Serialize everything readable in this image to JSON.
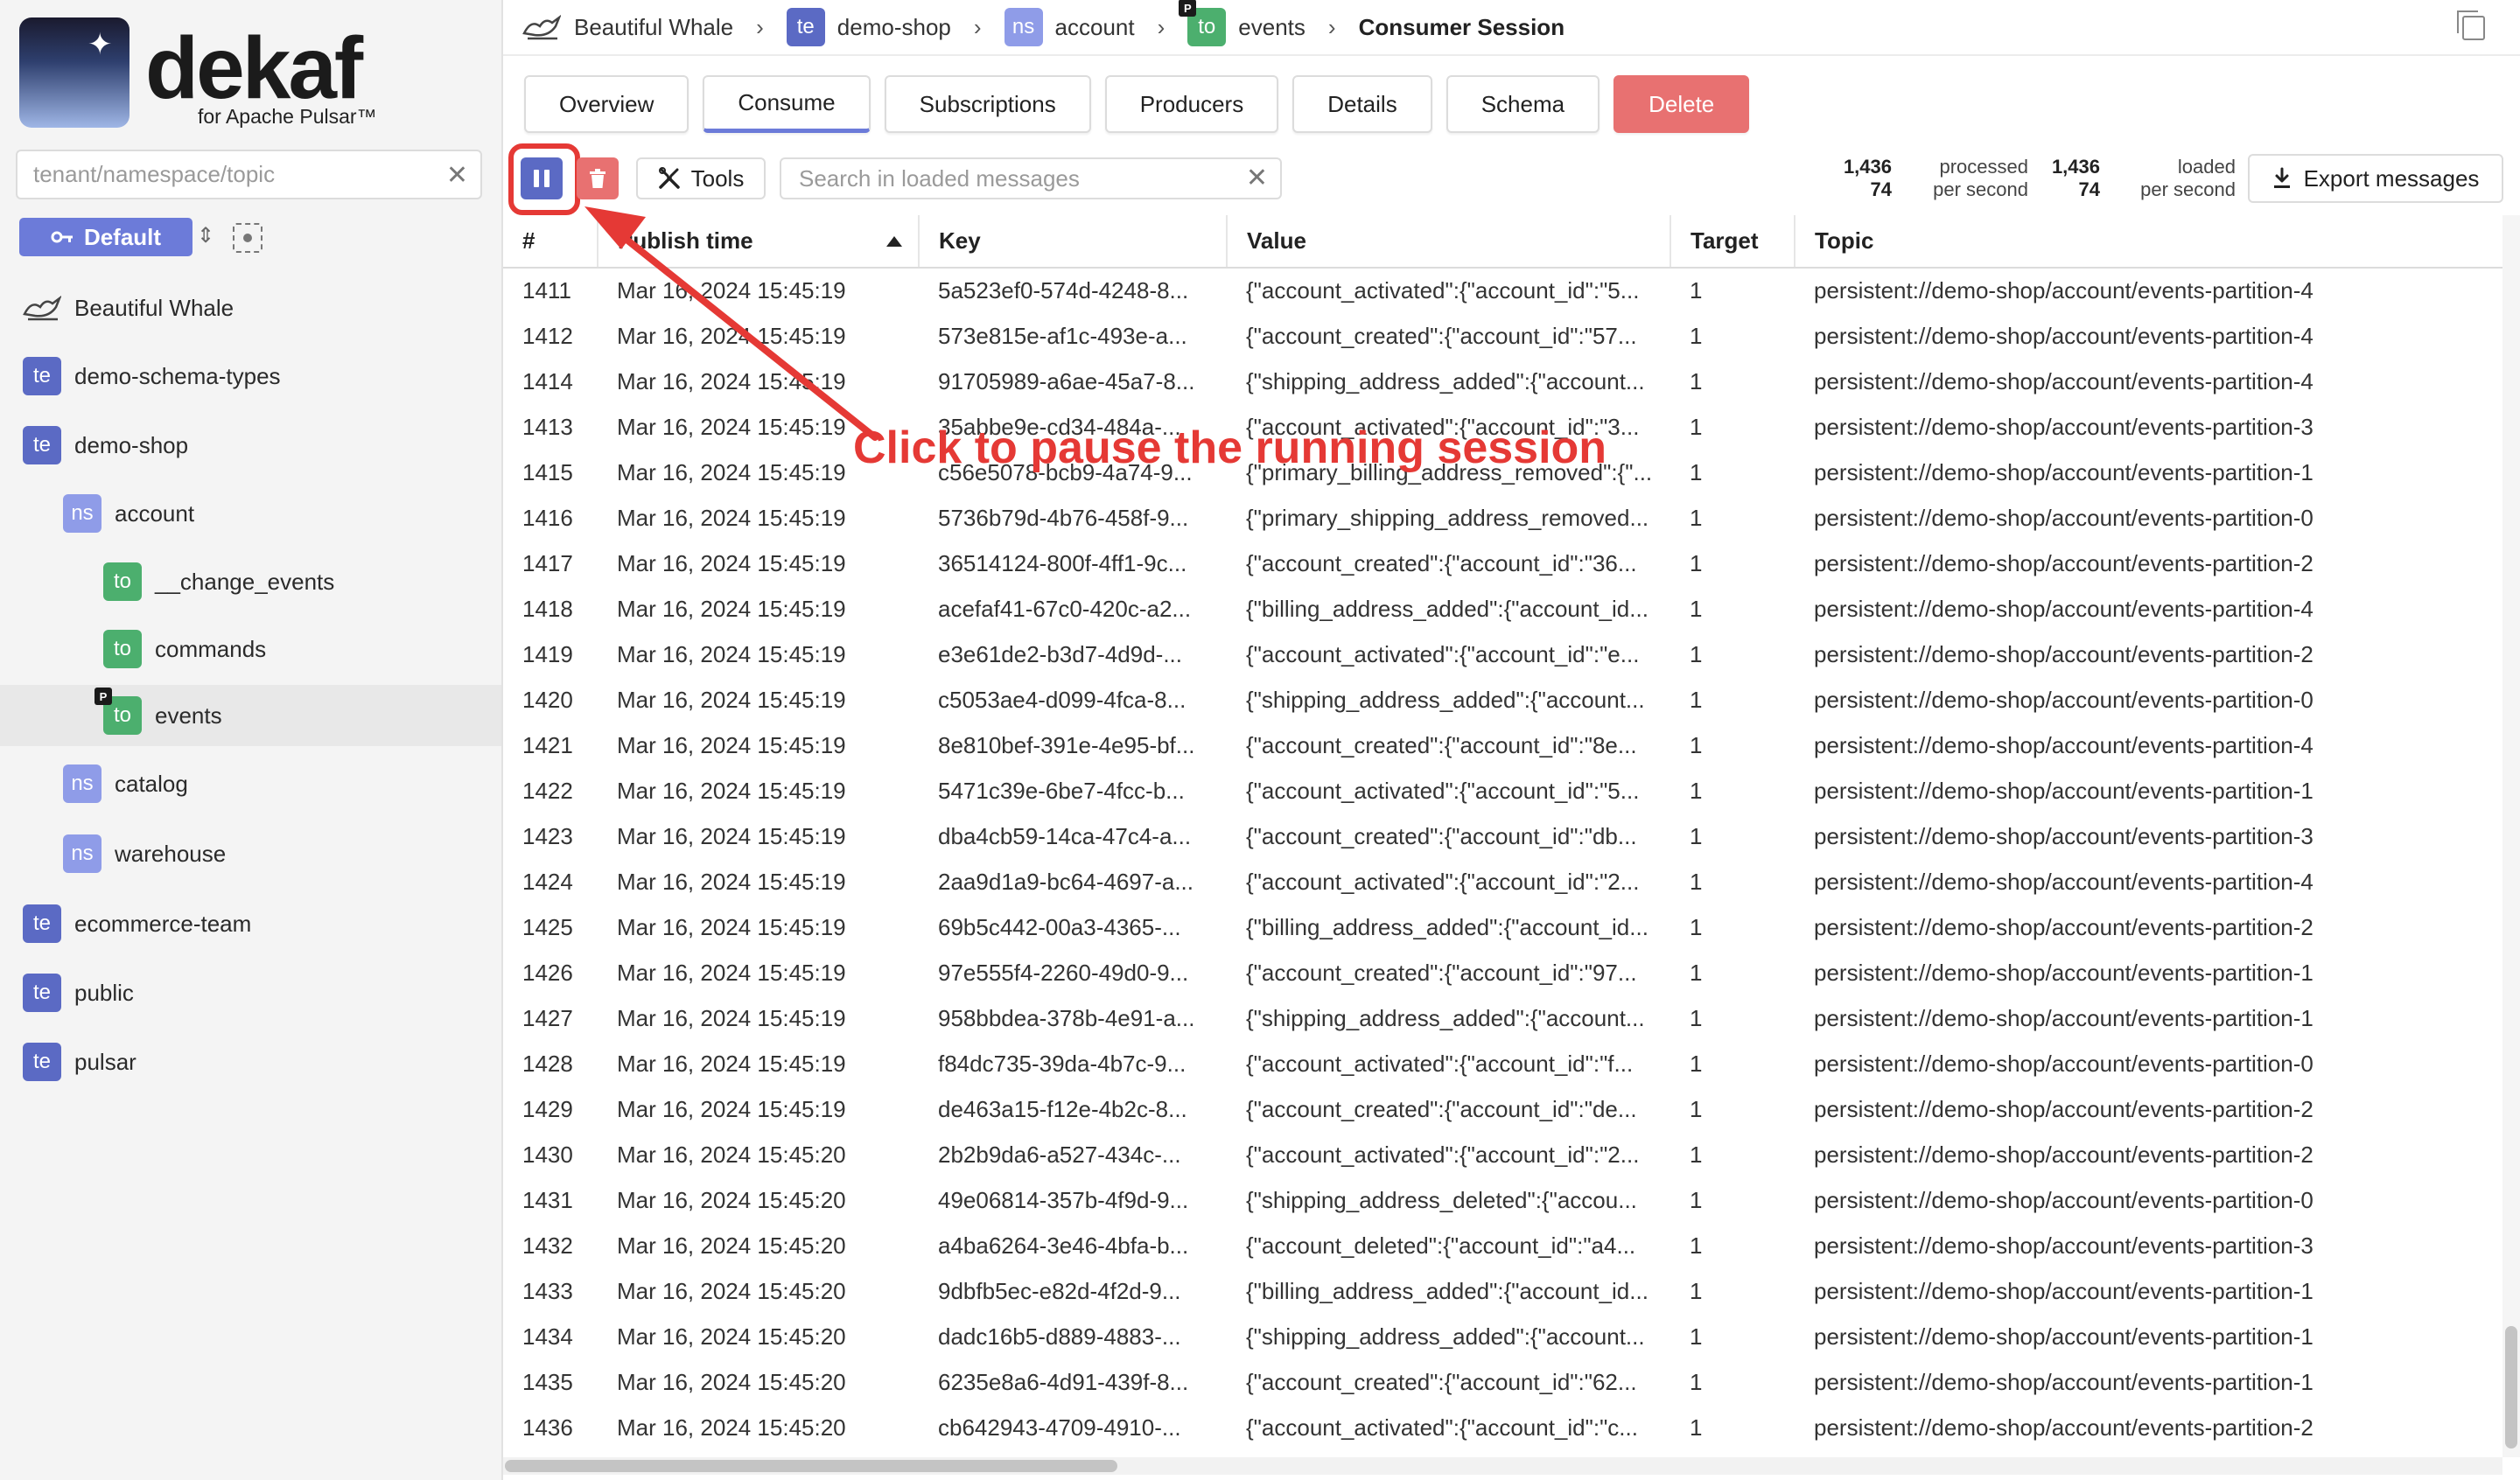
{
  "app": {
    "logo_text": "dekaf",
    "logo_sub": "for Apache Pulsar™"
  },
  "sidebar": {
    "filter_placeholder": "tenant/namespace/topic",
    "default_button": "Default",
    "items": [
      {
        "badge": "",
        "label": "Beautiful Whale"
      },
      {
        "badge": "te",
        "label": "demo-schema-types"
      },
      {
        "badge": "te",
        "label": "demo-shop"
      },
      {
        "badge": "ns",
        "label": "account"
      },
      {
        "badge": "to",
        "label": "__change_events"
      },
      {
        "badge": "to",
        "label": "commands"
      },
      {
        "badge": "to",
        "label": "events",
        "flag": "P"
      },
      {
        "badge": "ns",
        "label": "catalog"
      },
      {
        "badge": "ns",
        "label": "warehouse"
      },
      {
        "badge": "te",
        "label": "ecommerce-team"
      },
      {
        "badge": "te",
        "label": "public"
      },
      {
        "badge": "te",
        "label": "pulsar"
      }
    ]
  },
  "breadcrumb": {
    "cluster": "Beautiful Whale",
    "tenant_badge": "te",
    "tenant": "demo-shop",
    "namespace_badge": "ns",
    "namespace": "account",
    "topic_badge": "to",
    "topic_flag": "P",
    "topic": "events",
    "current": "Consumer Session"
  },
  "tabs": [
    {
      "label": "Overview"
    },
    {
      "label": "Consume"
    },
    {
      "label": "Subscriptions"
    },
    {
      "label": "Producers"
    },
    {
      "label": "Details"
    },
    {
      "label": "Schema"
    },
    {
      "label": "Delete"
    }
  ],
  "toolbar": {
    "tools_label": "Tools",
    "search_placeholder": "Search in loaded messages",
    "processed_total": "1,436",
    "processed_rate": "74",
    "processed_label_1": "processed",
    "processed_label_2": "per second",
    "loaded_total": "1,436",
    "loaded_rate": "74",
    "loaded_label_1": "loaded",
    "loaded_label_2": "per second",
    "export_label": "Export messages"
  },
  "table": {
    "columns": [
      "#",
      "Publish time",
      "Key",
      "Value",
      "Target",
      "Topic"
    ],
    "rows": [
      [
        "1411",
        "Mar 16, 2024 15:45:19",
        "5a523ef0-574d-4248-8...",
        "{\"account_activated\":{\"account_id\":\"5...",
        "1",
        "persistent://demo-shop/account/events-partition-4"
      ],
      [
        "1412",
        "Mar 16, 2024 15:45:19",
        "573e815e-af1c-493e-a...",
        "{\"account_created\":{\"account_id\":\"57...",
        "1",
        "persistent://demo-shop/account/events-partition-4"
      ],
      [
        "1414",
        "Mar 16, 2024 15:45:19",
        "91705989-a6ae-45a7-8...",
        "{\"shipping_address_added\":{\"account...",
        "1",
        "persistent://demo-shop/account/events-partition-4"
      ],
      [
        "1413",
        "Mar 16, 2024 15:45:19",
        "35abbe9e-cd34-484a-...",
        "{\"account_activated\":{\"account_id\":\"3...",
        "1",
        "persistent://demo-shop/account/events-partition-3"
      ],
      [
        "1415",
        "Mar 16, 2024 15:45:19",
        "c56e5078-bcb9-4a74-9...",
        "{\"primary_billing_address_removed\":{\"...",
        "1",
        "persistent://demo-shop/account/events-partition-1"
      ],
      [
        "1416",
        "Mar 16, 2024 15:45:19",
        "5736b79d-4b76-458f-9...",
        "{\"primary_shipping_address_removed...",
        "1",
        "persistent://demo-shop/account/events-partition-0"
      ],
      [
        "1417",
        "Mar 16, 2024 15:45:19",
        "36514124-800f-4ff1-9c...",
        "{\"account_created\":{\"account_id\":\"36...",
        "1",
        "persistent://demo-shop/account/events-partition-2"
      ],
      [
        "1418",
        "Mar 16, 2024 15:45:19",
        "acefaf41-67c0-420c-a2...",
        "{\"billing_address_added\":{\"account_id...",
        "1",
        "persistent://demo-shop/account/events-partition-4"
      ],
      [
        "1419",
        "Mar 16, 2024 15:45:19",
        "e3e61de2-b3d7-4d9d-...",
        "{\"account_activated\":{\"account_id\":\"e...",
        "1",
        "persistent://demo-shop/account/events-partition-2"
      ],
      [
        "1420",
        "Mar 16, 2024 15:45:19",
        "c5053ae4-d099-4fca-8...",
        "{\"shipping_address_added\":{\"account...",
        "1",
        "persistent://demo-shop/account/events-partition-0"
      ],
      [
        "1421",
        "Mar 16, 2024 15:45:19",
        "8e810bef-391e-4e95-bf...",
        "{\"account_created\":{\"account_id\":\"8e...",
        "1",
        "persistent://demo-shop/account/events-partition-4"
      ],
      [
        "1422",
        "Mar 16, 2024 15:45:19",
        "5471c39e-6be7-4fcc-b...",
        "{\"account_activated\":{\"account_id\":\"5...",
        "1",
        "persistent://demo-shop/account/events-partition-1"
      ],
      [
        "1423",
        "Mar 16, 2024 15:45:19",
        "dba4cb59-14ca-47c4-a...",
        "{\"account_created\":{\"account_id\":\"db...",
        "1",
        "persistent://demo-shop/account/events-partition-3"
      ],
      [
        "1424",
        "Mar 16, 2024 15:45:19",
        "2aa9d1a9-bc64-4697-a...",
        "{\"account_activated\":{\"account_id\":\"2...",
        "1",
        "persistent://demo-shop/account/events-partition-4"
      ],
      [
        "1425",
        "Mar 16, 2024 15:45:19",
        "69b5c442-00a3-4365-...",
        "{\"billing_address_added\":{\"account_id...",
        "1",
        "persistent://demo-shop/account/events-partition-2"
      ],
      [
        "1426",
        "Mar 16, 2024 15:45:19",
        "97e555f4-2260-49d0-9...",
        "{\"account_created\":{\"account_id\":\"97...",
        "1",
        "persistent://demo-shop/account/events-partition-1"
      ],
      [
        "1427",
        "Mar 16, 2024 15:45:19",
        "958bbdea-378b-4e91-a...",
        "{\"shipping_address_added\":{\"account...",
        "1",
        "persistent://demo-shop/account/events-partition-1"
      ],
      [
        "1428",
        "Mar 16, 2024 15:45:19",
        "f84dc735-39da-4b7c-9...",
        "{\"account_activated\":{\"account_id\":\"f...",
        "1",
        "persistent://demo-shop/account/events-partition-0"
      ],
      [
        "1429",
        "Mar 16, 2024 15:45:19",
        "de463a15-f12e-4b2c-8...",
        "{\"account_created\":{\"account_id\":\"de...",
        "1",
        "persistent://demo-shop/account/events-partition-2"
      ],
      [
        "1430",
        "Mar 16, 2024 15:45:20",
        "2b2b9da6-a527-434c-...",
        "{\"account_activated\":{\"account_id\":\"2...",
        "1",
        "persistent://demo-shop/account/events-partition-2"
      ],
      [
        "1431",
        "Mar 16, 2024 15:45:20",
        "49e06814-357b-4f9d-9...",
        "{\"shipping_address_deleted\":{\"accou...",
        "1",
        "persistent://demo-shop/account/events-partition-0"
      ],
      [
        "1432",
        "Mar 16, 2024 15:45:20",
        "a4ba6264-3e46-4bfa-b...",
        "{\"account_deleted\":{\"account_id\":\"a4...",
        "1",
        "persistent://demo-shop/account/events-partition-3"
      ],
      [
        "1433",
        "Mar 16, 2024 15:45:20",
        "9dbfb5ec-e82d-4f2d-9...",
        "{\"billing_address_added\":{\"account_id...",
        "1",
        "persistent://demo-shop/account/events-partition-1"
      ],
      [
        "1434",
        "Mar 16, 2024 15:45:20",
        "dadc16b5-d889-4883-...",
        "{\"shipping_address_added\":{\"account...",
        "1",
        "persistent://demo-shop/account/events-partition-1"
      ],
      [
        "1435",
        "Mar 16, 2024 15:45:20",
        "6235e8a6-4d91-439f-8...",
        "{\"account_created\":{\"account_id\":\"62...",
        "1",
        "persistent://demo-shop/account/events-partition-1"
      ],
      [
        "1436",
        "Mar 16, 2024 15:45:20",
        "cb642943-4709-4910-...",
        "{\"account_activated\":{\"account_id\":\"c...",
        "1",
        "persistent://demo-shop/account/events-partition-2"
      ]
    ]
  },
  "annotation": {
    "text": "Click to pause the running session",
    "color": "#e53935"
  },
  "colors": {
    "accent": "#5b6ac4",
    "namespace": "#8f9ce8",
    "topic": "#4caf6e",
    "danger": "#e87171"
  }
}
